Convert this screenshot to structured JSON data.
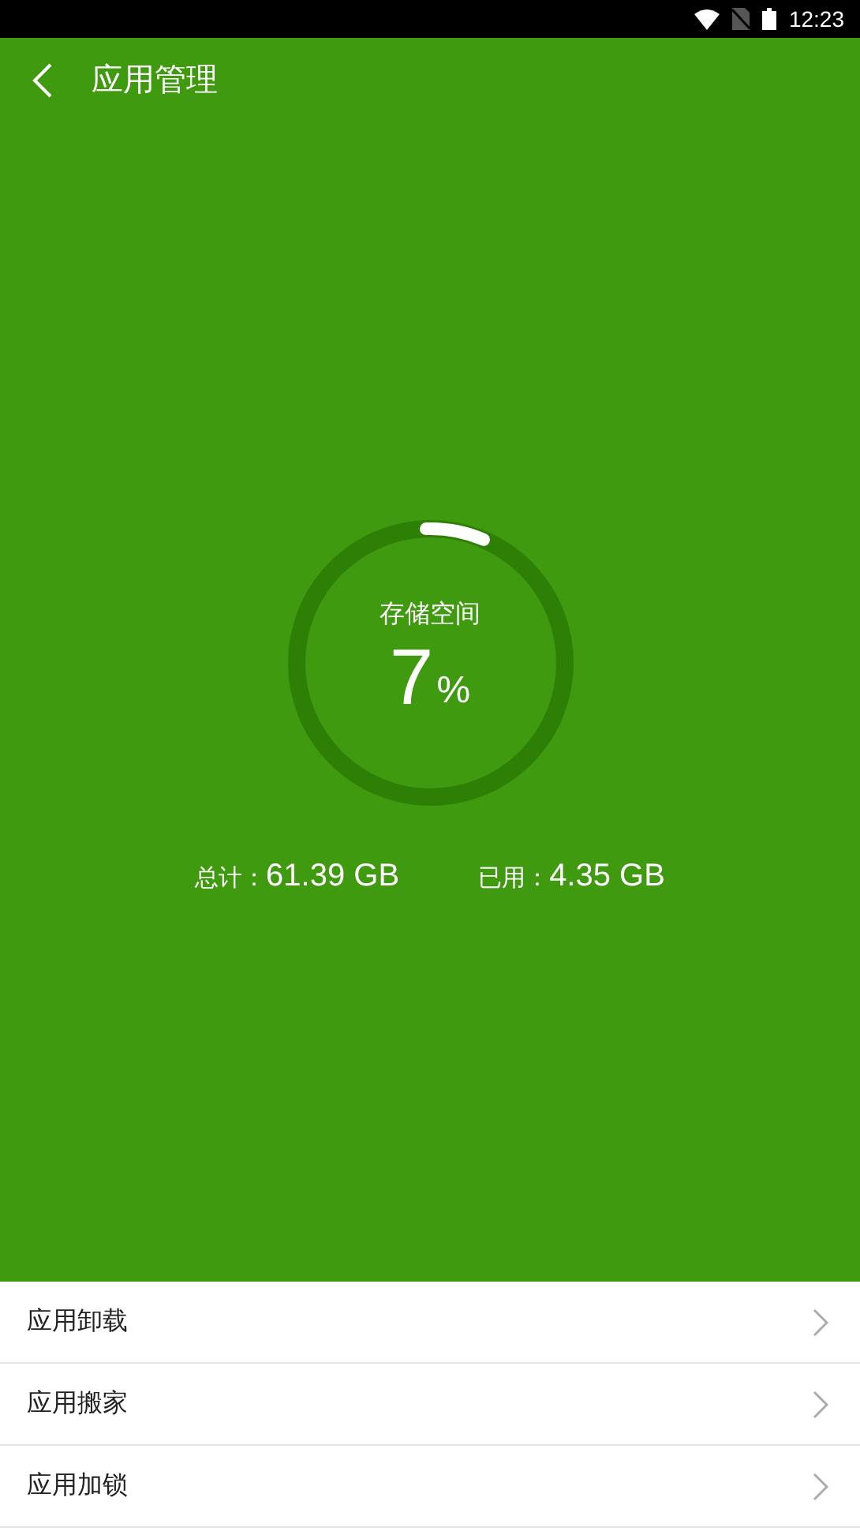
{
  "status_bar": {
    "time": "12:23"
  },
  "header": {
    "title": "应用管理"
  },
  "storage": {
    "label": "存储空间",
    "percent": "7",
    "unit": "%",
    "level": 0.07
  },
  "totals": [
    {
      "label": "总计：",
      "value": "61.39 GB"
    },
    {
      "label": "已用：",
      "value": "4.35 GB"
    }
  ],
  "menu": [
    {
      "label": "应用卸载"
    },
    {
      "label": "应用搬家"
    },
    {
      "label": "应用加锁"
    }
  ]
}
